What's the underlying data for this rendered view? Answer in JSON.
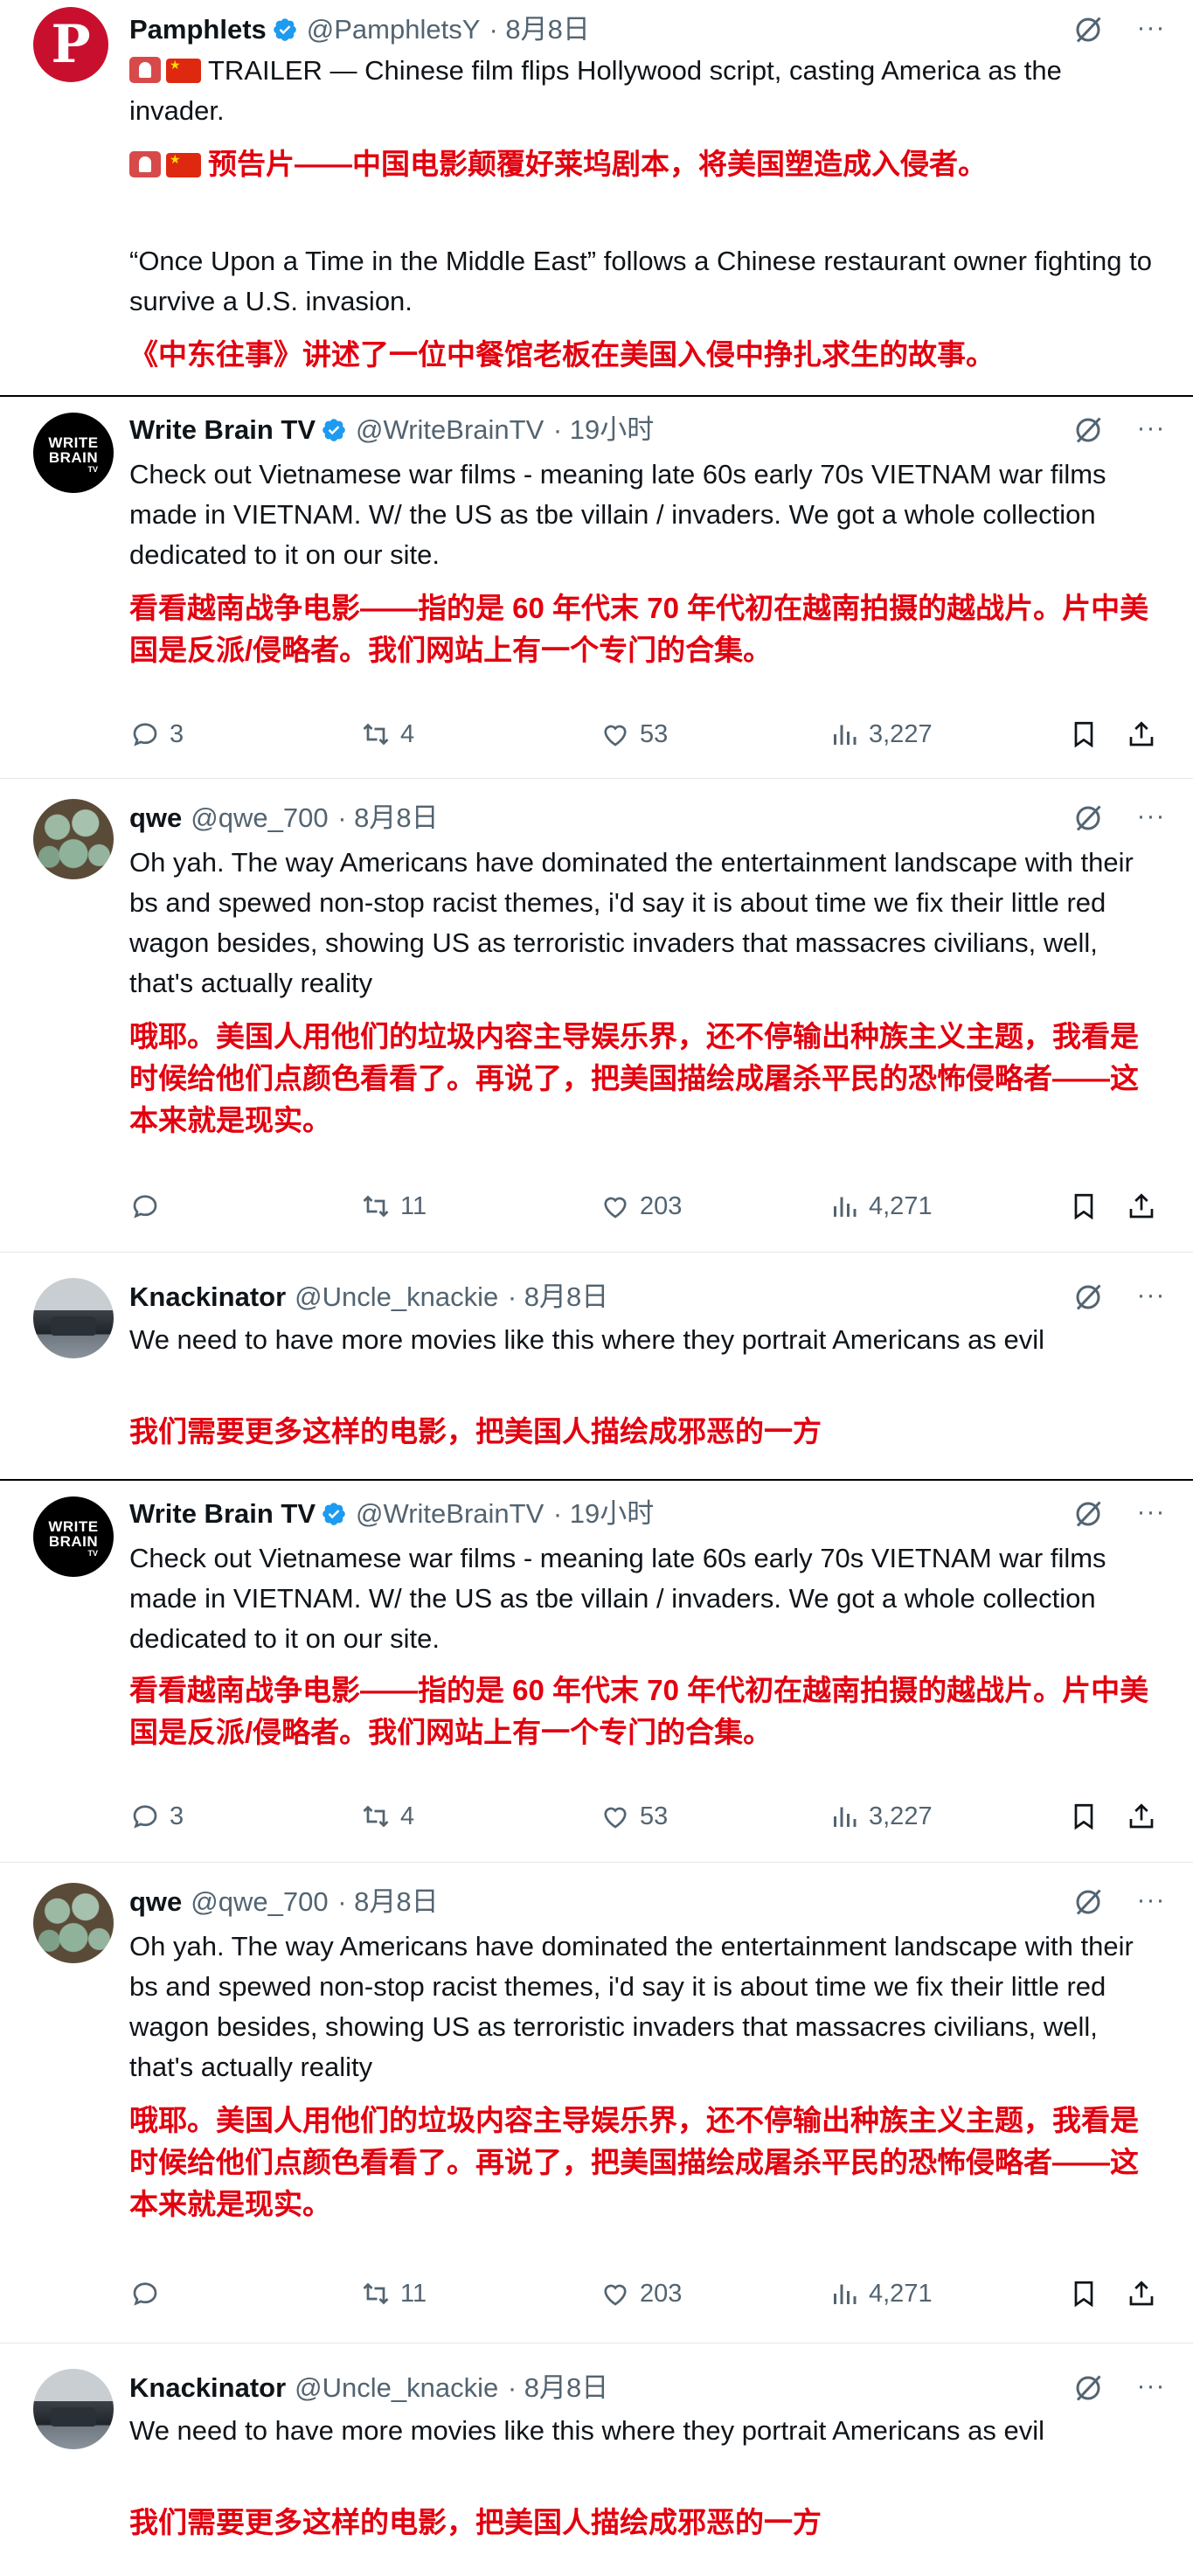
{
  "posts": [
    {
      "id": "p1",
      "name": "Pamphlets",
      "handle": "@PamphletsY",
      "time": "· 8月8日",
      "verified": true,
      "avatar_letter": "P",
      "en": [
        "TRAILER — Chinese film flips Hollywood script, casting America as the invader.",
        "“Once Upon a Time in the Middle East” follows a Chinese restaurant owner fighting to survive a U.S. invasion."
      ],
      "zh": [
        "预告片——中国电影颠覆好莱坞剧本，将美国塑造成入侵者。",
        "《中东往事》讲述了一位中餐馆老板在美国入侵中挣扎求生的故事。"
      ]
    },
    {
      "id": "p2",
      "name": "Write Brain TV",
      "handle": "@WriteBrainTV",
      "time": "· 19小时",
      "verified": true,
      "avatar_text": "WRITE BRAIN",
      "avatar_sub": "TV",
      "en": "Check out Vietnamese war films - meaning late 60s early 70s VIETNAM war films made in VIETNAM. W/ the US as tbe villain / invaders. We got a whole collection dedicated to it on our site.",
      "zh": "看看越南战争电影——指的是 60 年代末 70 年代初在越南拍摄的越战片。片中美国是反派/侵略者。我们网站上有一个专门的合集。",
      "replies": "3",
      "retweets": "4",
      "likes": "53",
      "views": "3,227"
    },
    {
      "id": "p3",
      "name": "qwe",
      "handle": "@qwe_700",
      "time": "· 8月8日",
      "verified": false,
      "en": "Oh yah. The way Americans have dominated the entertainment landscape with their bs and spewed non-stop racist themes, i'd say it is about time we fix their little red wagon besides, showing US as terroristic invaders that massacres civilians, well, that's actually reality",
      "zh": "哦耶。美国人用他们的垃圾内容主导娱乐界，还不停输出种族主义主题，我看是时候给他们点颜色看看了。再说了，把美国描绘成屠杀平民的恐怖侵略者——这本来就是现实。",
      "replies": "",
      "retweets": "11",
      "likes": "203",
      "views": "4,271"
    },
    {
      "id": "p4",
      "name": "Knackinator",
      "handle": "@Uncle_knackie",
      "time": "· 8月8日",
      "verified": false,
      "en": "We need to have more movies like this where they portrait Americans as evil",
      "zh": "我们需要更多这样的电影，把美国人描绘成邪恶的一方"
    },
    {
      "id": "p5",
      "name": "Write Brain TV",
      "handle": "@WriteBrainTV",
      "time": "· 19小时",
      "verified": true,
      "avatar_text": "WRITE BRAIN",
      "avatar_sub": "TV",
      "en": "Check out Vietnamese war films - meaning late 60s early 70s VIETNAM war films made in VIETNAM. W/ the US as tbe villain / invaders. We got a whole collection dedicated to it on our site.",
      "zh": "看看越南战争电影——指的是 60 年代末 70 年代初在越南拍摄的越战片。片中美国是反派/侵略者。我们网站上有一个专门的合集。",
      "replies": "3",
      "retweets": "4",
      "likes": "53",
      "views": "3,227"
    },
    {
      "id": "p6",
      "name": "qwe",
      "handle": "@qwe_700",
      "time": "· 8月8日",
      "verified": false,
      "en": "Oh yah. The way Americans have dominated the entertainment landscape with their bs and spewed non-stop racist themes, i'd say it is about time we fix their little red wagon besides, showing US as terroristic invaders that massacres civilians, well, that's actually reality",
      "zh": "哦耶。美国人用他们的垃圾内容主导娱乐界，还不停输出种族主义主题，我看是时候给他们点颜色看看了。再说了，把美国描绘成屠杀平民的恐怖侵略者——这本来就是现实。",
      "replies": "",
      "retweets": "11",
      "likes": "203",
      "views": "4,271"
    },
    {
      "id": "p7",
      "name": "Knackinator",
      "handle": "@Uncle_knackie",
      "time": "· 8月8日",
      "verified": false,
      "en": "We need to have more movies like this where they portrait Americans as evil",
      "zh": "我们需要更多这样的电影，把美国人描绘成邪恶的一方"
    }
  ],
  "icons": {
    "verified": "verified-badge-icon",
    "grok": "grok-icon",
    "more": "more-icon",
    "reply": "reply-icon",
    "retweet": "retweet-icon",
    "like": "like-icon",
    "views": "views-icon",
    "bookmark": "bookmark-icon",
    "share": "share-icon"
  },
  "colors": {
    "verified": "#1d9bf0",
    "translation": "#e3000f",
    "muted": "#536471",
    "pamphlets_brand": "#c8102e"
  }
}
